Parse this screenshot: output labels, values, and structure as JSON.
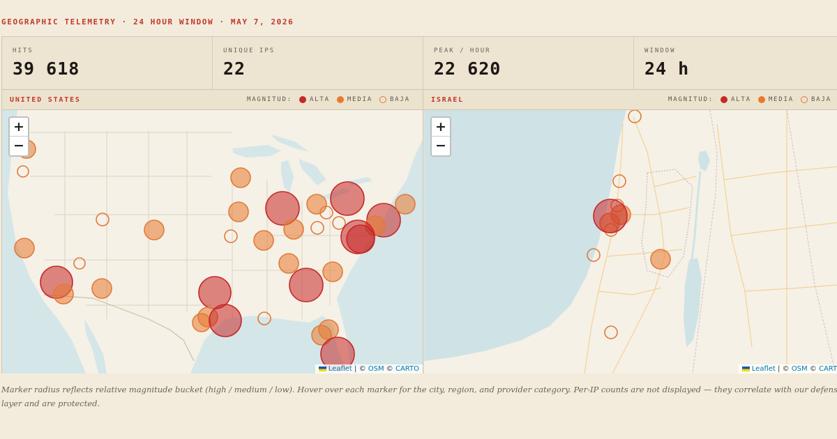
{
  "header": {
    "kicker": "GEOGRAPHIC TELEMETRY · 24 HOUR WINDOW · MAY 7, 2026"
  },
  "stats": [
    {
      "label": "HITS",
      "value": "39 618"
    },
    {
      "label": "UNIQUE IPS",
      "value": "22"
    },
    {
      "label": "PEAK / HOUR",
      "value": "22 620"
    },
    {
      "label": "WINDOW",
      "value": "24 h"
    }
  ],
  "legend": {
    "title": "MAGNITUD:",
    "alta": "ALTA",
    "media": "MEDIA",
    "baja": "BAJA"
  },
  "colors": {
    "alta": "#c62828",
    "media": "#e87a2f",
    "baja": "#e07a3a",
    "accent": "#c0392b",
    "water": "#cfe3e6",
    "land": "#f5f1e7"
  },
  "panels": [
    {
      "title": "UNITED STATES"
    },
    {
      "title": "ISRAEL"
    }
  ],
  "zoom": {
    "in": "+",
    "out": "−"
  },
  "attribution": {
    "leaflet": "Leaflet",
    "sep1": " | © ",
    "osm": "OSM",
    "sep2": " © ",
    "carto": "CARTO"
  },
  "caption": "Marker radius reflects relative magnitude bucket (high / medium / low). Hover over each marker for the city, region, and provider category. Per-IP counts are not displayed — they correlate with our defense layer and are protected."
}
